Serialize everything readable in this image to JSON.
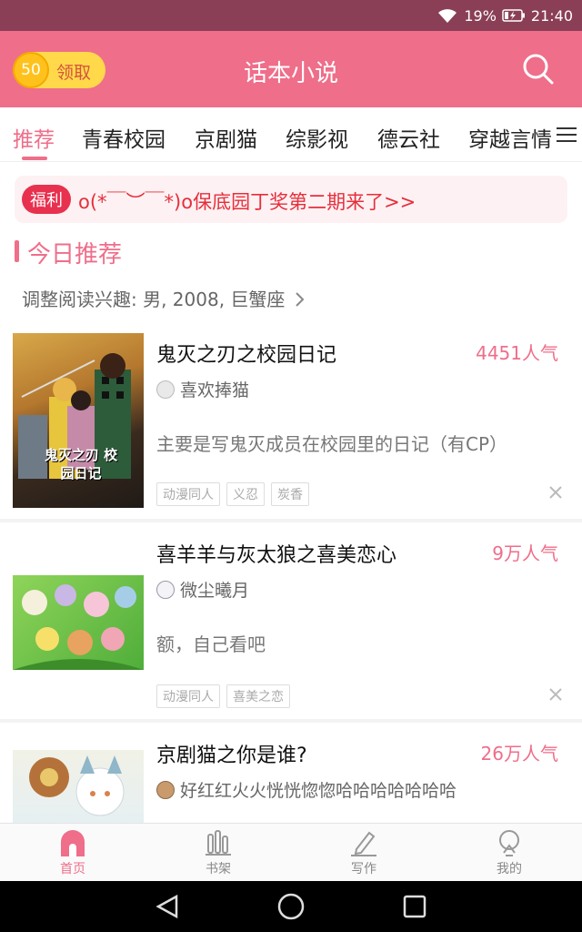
{
  "status_bar": {
    "battery": "19%",
    "time": "21:40"
  },
  "header": {
    "coin_count": "50",
    "claim_label": "领取",
    "title": "话本小说"
  },
  "tabs": [
    "推荐",
    "青春校园",
    "京剧猫",
    "综影视",
    "德云社",
    "穿越言情"
  ],
  "notice": {
    "badge": "福利",
    "text": "o(*￣︶￣*)o保底园丁奖第二期来了>>"
  },
  "section": {
    "title": "今日推荐",
    "interest": "调整阅读兴趣: 男, 2008, 巨蟹座"
  },
  "books": [
    {
      "title": "鬼灭之刃之校园日记",
      "popularity": "4451人气",
      "author": "喜欢捧猫",
      "desc": "主要是写鬼灭成员在校园里的日记（有CP）",
      "tags": [
        "动漫同人",
        "义忍",
        "炭香"
      ],
      "cover_text": "鬼灭之刃 校园日记"
    },
    {
      "title": "喜羊羊与灰太狼之喜美恋心",
      "popularity": "9万人气",
      "author": "微尘曦月",
      "desc": "额，自己看吧",
      "tags": [
        "动漫同人",
        "喜美之恋"
      ]
    },
    {
      "title": "京剧猫之你是谁?",
      "popularity": "26万人气",
      "author": "好红红火火恍恍惚惚哈哈哈哈哈哈哈"
    }
  ],
  "bottom_nav": [
    "首页",
    "书架",
    "写作",
    "我的"
  ],
  "colors": {
    "accent": "#ef6e8a",
    "status_bar": "#8a3f56",
    "notice_text": "#e62f3b"
  }
}
